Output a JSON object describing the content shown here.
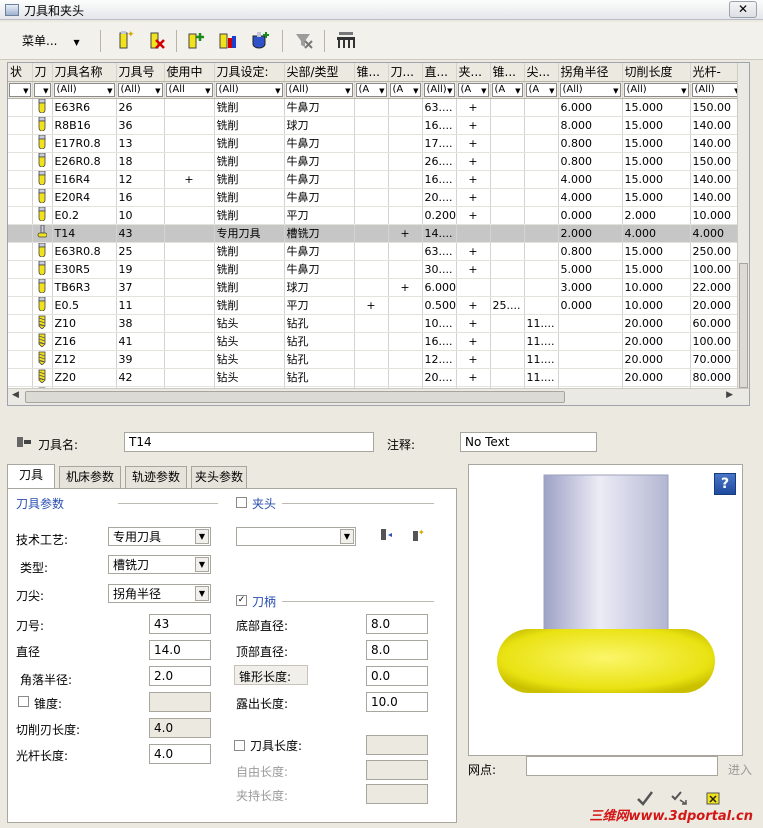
{
  "window": {
    "title": "刀具和夹头",
    "close": "✕"
  },
  "toolbar": {
    "menu_label": "菜单..."
  },
  "table": {
    "headers": [
      "状",
      "刀",
      "刀具名称",
      "刀具号",
      "使用中",
      "刀具设定:",
      "尖部/类型",
      "锥...",
      "刀...",
      "直...",
      "夹...",
      "锥...",
      "尖...",
      "拐角半径",
      "切削长度",
      "光杆-"
    ],
    "filters": [
      "",
      "",
      "(All)",
      "(All)",
      "(All",
      "(All)",
      "(All)",
      "(A",
      "(A",
      "(All)",
      "(A",
      "(A",
      "(A",
      "(All)",
      "(All)",
      "(All)"
    ],
    "rows": [
      {
        "icon": "mill",
        "name": "E63R6",
        "num": "26",
        "inuse": "",
        "setting": "铣削",
        "tip": "牛鼻刀",
        "taper": "",
        "holder": "",
        "dia": "63....",
        "clamp": "+",
        "cone": "",
        "tipx": "",
        "corner": "6.000",
        "cut": "15.000",
        "shank": "150.00"
      },
      {
        "icon": "mill",
        "name": "R8B16",
        "num": "36",
        "inuse": "",
        "setting": "铣削",
        "tip": "球刀",
        "taper": "",
        "holder": "",
        "dia": "16....",
        "clamp": "+",
        "cone": "",
        "tipx": "",
        "corner": "8.000",
        "cut": "15.000",
        "shank": "140.00"
      },
      {
        "icon": "mill",
        "name": "E17R0.8",
        "num": "13",
        "inuse": "",
        "setting": "铣削",
        "tip": "牛鼻刀",
        "taper": "",
        "holder": "",
        "dia": "17....",
        "clamp": "+",
        "cone": "",
        "tipx": "",
        "corner": "0.800",
        "cut": "15.000",
        "shank": "140.00"
      },
      {
        "icon": "mill",
        "name": "E26R0.8",
        "num": "18",
        "inuse": "",
        "setting": "铣削",
        "tip": "牛鼻刀",
        "taper": "",
        "holder": "",
        "dia": "26....",
        "clamp": "+",
        "cone": "",
        "tipx": "",
        "corner": "0.800",
        "cut": "15.000",
        "shank": "150.00"
      },
      {
        "icon": "mill",
        "name": "E16R4",
        "num": "12",
        "inuse": "+",
        "setting": "铣削",
        "tip": "牛鼻刀",
        "taper": "",
        "holder": "",
        "dia": "16....",
        "clamp": "+",
        "cone": "",
        "tipx": "",
        "corner": "4.000",
        "cut": "15.000",
        "shank": "140.00"
      },
      {
        "icon": "mill",
        "name": "E20R4",
        "num": "16",
        "inuse": "",
        "setting": "铣削",
        "tip": "牛鼻刀",
        "taper": "",
        "holder": "",
        "dia": "20....",
        "clamp": "+",
        "cone": "",
        "tipx": "",
        "corner": "4.000",
        "cut": "15.000",
        "shank": "140.00"
      },
      {
        "icon": "mill",
        "name": "E0.2",
        "num": "10",
        "inuse": "",
        "setting": "铣削",
        "tip": "平刀",
        "taper": "",
        "holder": "",
        "dia": "0.200",
        "clamp": "+",
        "cone": "",
        "tipx": "",
        "corner": "0.000",
        "cut": "2.000",
        "shank": "10.000"
      },
      {
        "icon": "special",
        "name": "T14",
        "num": "43",
        "inuse": "",
        "setting": "专用刀具",
        "tip": "槽铣刀",
        "taper": "",
        "holder": "+",
        "dia": "14....",
        "clamp": "",
        "cone": "",
        "tipx": "",
        "corner": "2.000",
        "cut": "4.000",
        "shank": "4.000",
        "selected": true
      },
      {
        "icon": "mill",
        "name": "E63R0.8",
        "num": "25",
        "inuse": "",
        "setting": "铣削",
        "tip": "牛鼻刀",
        "taper": "",
        "holder": "",
        "dia": "63....",
        "clamp": "+",
        "cone": "",
        "tipx": "",
        "corner": "0.800",
        "cut": "15.000",
        "shank": "250.00"
      },
      {
        "icon": "mill",
        "name": "E30R5",
        "num": "19",
        "inuse": "",
        "setting": "铣削",
        "tip": "牛鼻刀",
        "taper": "",
        "holder": "",
        "dia": "30....",
        "clamp": "+",
        "cone": "",
        "tipx": "",
        "corner": "5.000",
        "cut": "15.000",
        "shank": "100.00"
      },
      {
        "icon": "mill",
        "name": "TB6R3",
        "num": "37",
        "inuse": "",
        "setting": "铣削",
        "tip": "球刀",
        "taper": "",
        "holder": "+",
        "dia": "6.000",
        "clamp": "",
        "cone": "",
        "tipx": "",
        "corner": "3.000",
        "cut": "10.000",
        "shank": "22.000"
      },
      {
        "icon": "mill",
        "name": "E0.5",
        "num": "11",
        "inuse": "",
        "setting": "铣削",
        "tip": "平刀",
        "taper": "+",
        "holder": "",
        "dia": "0.500",
        "clamp": "+",
        "cone": "25....",
        "tipx": "",
        "corner": "0.000",
        "cut": "10.000",
        "shank": "20.000"
      },
      {
        "icon": "drill",
        "name": "Z10",
        "num": "38",
        "inuse": "",
        "setting": "钻头",
        "tip": "钻孔",
        "taper": "",
        "holder": "",
        "dia": "10....",
        "clamp": "+",
        "cone": "",
        "tipx": "11....",
        "corner": "",
        "cut": "20.000",
        "shank": "60.000"
      },
      {
        "icon": "drill",
        "name": "Z16",
        "num": "41",
        "inuse": "",
        "setting": "钻头",
        "tip": "钻孔",
        "taper": "",
        "holder": "",
        "dia": "16....",
        "clamp": "+",
        "cone": "",
        "tipx": "11....",
        "corner": "",
        "cut": "20.000",
        "shank": "100.00"
      },
      {
        "icon": "drill",
        "name": "Z12",
        "num": "39",
        "inuse": "",
        "setting": "钻头",
        "tip": "钻孔",
        "taper": "",
        "holder": "",
        "dia": "12....",
        "clamp": "+",
        "cone": "",
        "tipx": "11....",
        "corner": "",
        "cut": "20.000",
        "shank": "70.000"
      },
      {
        "icon": "drill",
        "name": "Z20",
        "num": "42",
        "inuse": "",
        "setting": "钻头",
        "tip": "钻孔",
        "taper": "",
        "holder": "",
        "dia": "20....",
        "clamp": "+",
        "cone": "",
        "tipx": "11....",
        "corner": "",
        "cut": "20.000",
        "shank": "80.000"
      },
      {
        "icon": "drill",
        "name": "Z14",
        "num": "40",
        "inuse": "",
        "setting": "钻头",
        "tip": "钻孔",
        "taper": "",
        "holder": "",
        "dia": "14....",
        "clamp": "+",
        "cone": "",
        "tipx": "11....",
        "corner": "",
        "cut": "15.000",
        "shank": "80.000"
      }
    ]
  },
  "detail": {
    "tool_name_label": "刀具名:",
    "tool_name_value": "T14",
    "note_label": "注释:",
    "note_value": "No Text",
    "tabs": [
      "刀具",
      "机床参数",
      "轨迹参数",
      "夹头参数"
    ],
    "tool_params_heading": "刀具参数",
    "process_label": "技术工艺:",
    "process_value": "专用刀具",
    "type_label": "类型:",
    "type_value": "槽铣刀",
    "tip_label": "刀尖:",
    "tip_value": "拐角半径",
    "num_label": "刀号:",
    "num_value": "43",
    "dia_label": "直径",
    "dia_value": "14.0",
    "corner_label": "角落半径:",
    "corner_value": "2.0",
    "taper_label": "锥度:",
    "taper_value": "",
    "cutlen_label": "切削刃长度:",
    "cutlen_value": "4.0",
    "shank_label": "光杆长度:",
    "shank_value": "4.0",
    "chuck_label": "夹头",
    "chuck_value": "",
    "holder_label": "刀柄",
    "bottom_dia_label": "底部直径:",
    "bottom_dia_value": "8.0",
    "top_dia_label": "顶部直径:",
    "top_dia_value": "8.0",
    "taper_len_label": "锥形长度:",
    "taper_len_value": "0.0",
    "exposed_label": "露出长度:",
    "exposed_value": "10.0",
    "tool_len_label": "刀具长度:",
    "free_len_label": "自由长度:",
    "clamp_len_label": "夹持长度:",
    "mesh_label": "网点:",
    "mesh_value": "",
    "enter_label": "进入",
    "help": "?"
  },
  "watermark": "三维网www.3dportal.cn",
  "colors": {
    "selected_row": "#c6c6c6",
    "tool_yellow": "#f5ee1e",
    "shank_gray": "#c9ccde",
    "section_blue": "#2a4fb0"
  }
}
